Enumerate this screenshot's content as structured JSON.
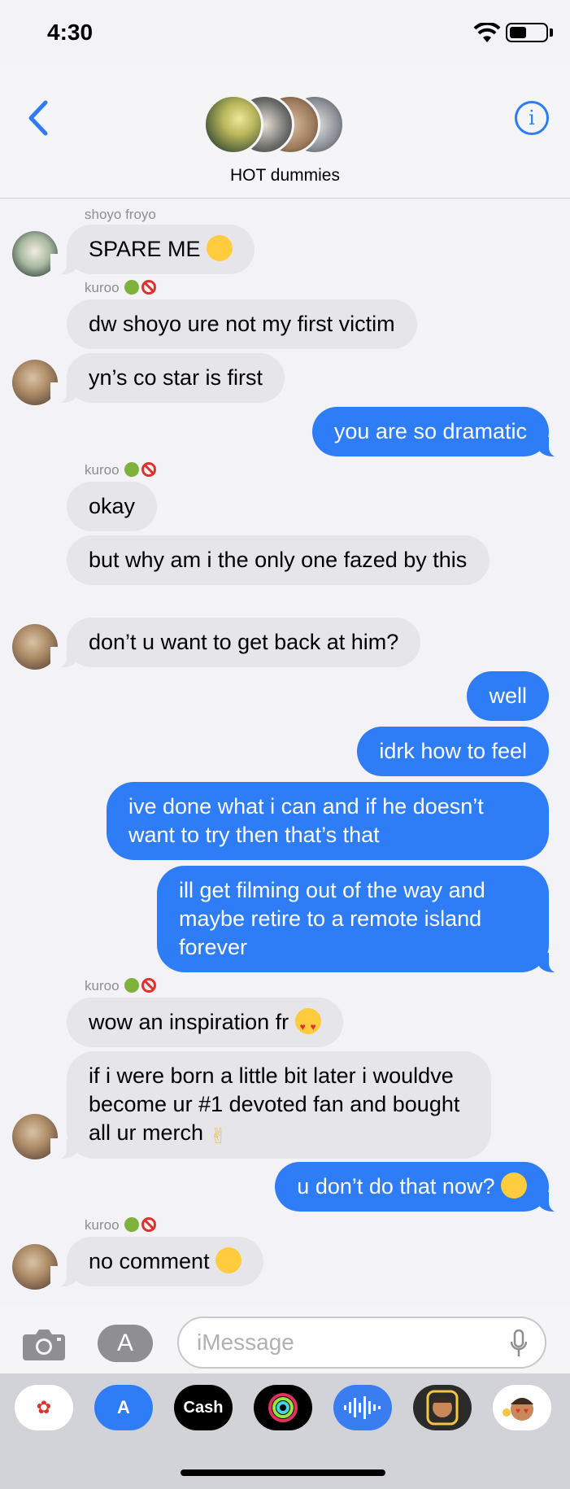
{
  "status_bar": {
    "time": "4:30"
  },
  "header": {
    "group_name": "HOT dummies",
    "info_label": "i"
  },
  "messages": [
    {
      "sender": "shoyo froyo",
      "text": "SPARE ME",
      "direction": "incoming",
      "emoji": "anxious-sweat-face"
    },
    {
      "sender": "kuroo",
      "text": "dw shoyo ure not my first victim",
      "direction": "incoming"
    },
    {
      "text": "yn’s co star is first",
      "direction": "incoming"
    },
    {
      "text": "you are so dramatic",
      "direction": "outgoing"
    },
    {
      "sender": "kuroo",
      "text": "okay",
      "direction": "incoming"
    },
    {
      "text": "but why am i the only one fazed by this",
      "direction": "incoming"
    },
    {
      "text": "don’t u want to get back at him?",
      "direction": "incoming"
    },
    {
      "text": "well",
      "direction": "outgoing"
    },
    {
      "text": "idrk how to feel",
      "direction": "outgoing"
    },
    {
      "text": "ive done what i can and if he doesn’t want to try then that’s that",
      "direction": "outgoing"
    },
    {
      "text": "ill get filming out of the way and maybe retire to a remote island forever",
      "direction": "outgoing"
    },
    {
      "sender": "kuroo",
      "text": "wow an inspiration fr",
      "direction": "incoming",
      "emoji": "heart-eyes-face"
    },
    {
      "text": "if i were born a little bit later i wouldve become ur #1 devoted fan and bought all ur merch",
      "direction": "incoming",
      "emoji": "crossed-fingers"
    },
    {
      "text": "u don’t do that now?",
      "direction": "outgoing",
      "emoji": "raised-eyebrow-face"
    },
    {
      "sender": "kuroo",
      "text": "no comment",
      "direction": "incoming",
      "emoji": "smiling-face"
    }
  ],
  "input": {
    "placeholder": "iMessage"
  },
  "app_drawer": {
    "apps": [
      "Photos",
      "App Store",
      "Cash",
      "Activity",
      "Audio",
      "Memoji",
      "Stickers"
    ],
    "cash_label": "Cash"
  },
  "colors": {
    "outgoing_bubble": "#2e7cf6",
    "incoming_bubble": "#e5e5ea",
    "accent": "#2f7cf6"
  }
}
